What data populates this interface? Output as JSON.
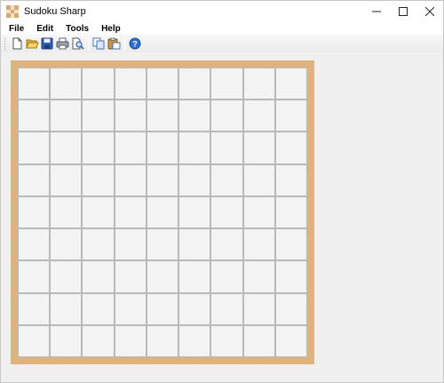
{
  "window": {
    "title": "Sudoku Sharp"
  },
  "window_controls": [
    {
      "name": "minimize-button",
      "glyph": "—"
    },
    {
      "name": "maximize-button",
      "glyph": "☐"
    },
    {
      "name": "close-button",
      "glyph": "✕"
    }
  ],
  "menu": {
    "items": [
      "File",
      "Edit",
      "Tools",
      "Help"
    ]
  },
  "toolbar": {
    "buttons": [
      "new-file-icon",
      "open-folder-icon",
      "save-icon",
      "print-icon",
      "print-preview-icon",
      "copy-icon",
      "paste-icon",
      "help-icon"
    ]
  },
  "board": {
    "rows": 9,
    "columns": 9,
    "cells": []
  },
  "colors": {
    "frame": "#dfb37e",
    "cell": "#f3f3f3",
    "gridline": "#b9b9b9"
  }
}
